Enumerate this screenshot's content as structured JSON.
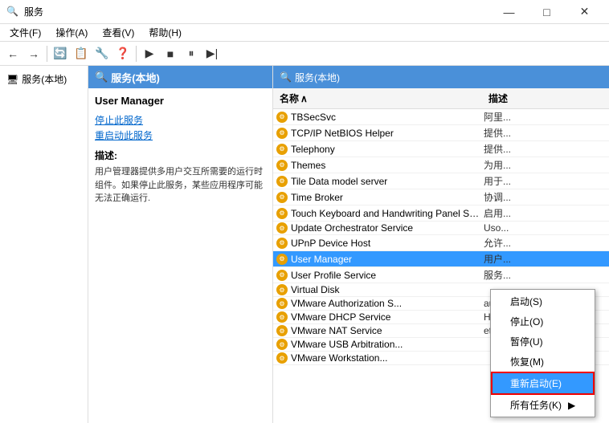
{
  "titleBar": {
    "icon": "⚙",
    "title": "服务",
    "minimize": "—",
    "maximize": "□",
    "close": "✕"
  },
  "menuBar": {
    "items": [
      "文件(F)",
      "操作(A)",
      "查看(V)",
      "帮助(H)"
    ]
  },
  "toolbar": {
    "buttons": [
      "←",
      "→",
      "▶",
      "■",
      "⏸",
      "▶|"
    ]
  },
  "leftNav": {
    "items": [
      "服务(本地)"
    ]
  },
  "centerPanel": {
    "header": "服务(本地)",
    "serviceTitle": "User Manager",
    "actions": [
      "停止此服务",
      "重启动此服务"
    ],
    "descLabel": "描述:",
    "descText": "用户管理器提供多用户交互所需要的运行时组件。如果停止此服务，某些应用程序可能无法正确运行."
  },
  "rightPanel": {
    "header": "服务(本地)",
    "columns": {
      "name": "名称",
      "desc": "描述"
    },
    "sortArrow": "∧",
    "services": [
      {
        "name": "TBSecSvc",
        "desc": "阿里..."
      },
      {
        "name": "TCP/IP NetBIOS Helper",
        "desc": "提供..."
      },
      {
        "name": "Telephony",
        "desc": "提供..."
      },
      {
        "name": "Themes",
        "desc": "为用..."
      },
      {
        "name": "Tile Data model server",
        "desc": "用于..."
      },
      {
        "name": "Time Broker",
        "desc": "协调..."
      },
      {
        "name": "Touch Keyboard and Handwriting Panel Servi...",
        "desc": "启用..."
      },
      {
        "name": "Update Orchestrator Service",
        "desc": "Uso..."
      },
      {
        "name": "UPnP Device Host",
        "desc": "允许..."
      },
      {
        "name": "User Manager",
        "desc": "用户...",
        "selected": true
      },
      {
        "name": "User Profile Service",
        "desc": "服务..."
      },
      {
        "name": "Virtual Disk",
        "desc": ""
      },
      {
        "name": "VMware Authorization S...",
        "desc": "auth..."
      },
      {
        "name": "VMware DHCP Service",
        "desc": "HC..."
      },
      {
        "name": "VMware NAT Service",
        "desc": "et..."
      },
      {
        "name": "VMware USB Arbitration...",
        "desc": ""
      },
      {
        "name": "VMware Workstation...",
        "desc": ""
      }
    ]
  },
  "contextMenu": {
    "items": [
      {
        "label": "启动(S)",
        "highlighted": false
      },
      {
        "label": "停止(O)",
        "highlighted": false
      },
      {
        "label": "暂停(U)",
        "highlighted": false
      },
      {
        "label": "恢复(M)",
        "highlighted": false
      },
      {
        "label": "重新启动(E)",
        "highlighted": true
      },
      {
        "label": "所有任务(K)",
        "highlighted": false,
        "hasArrow": true
      }
    ]
  }
}
